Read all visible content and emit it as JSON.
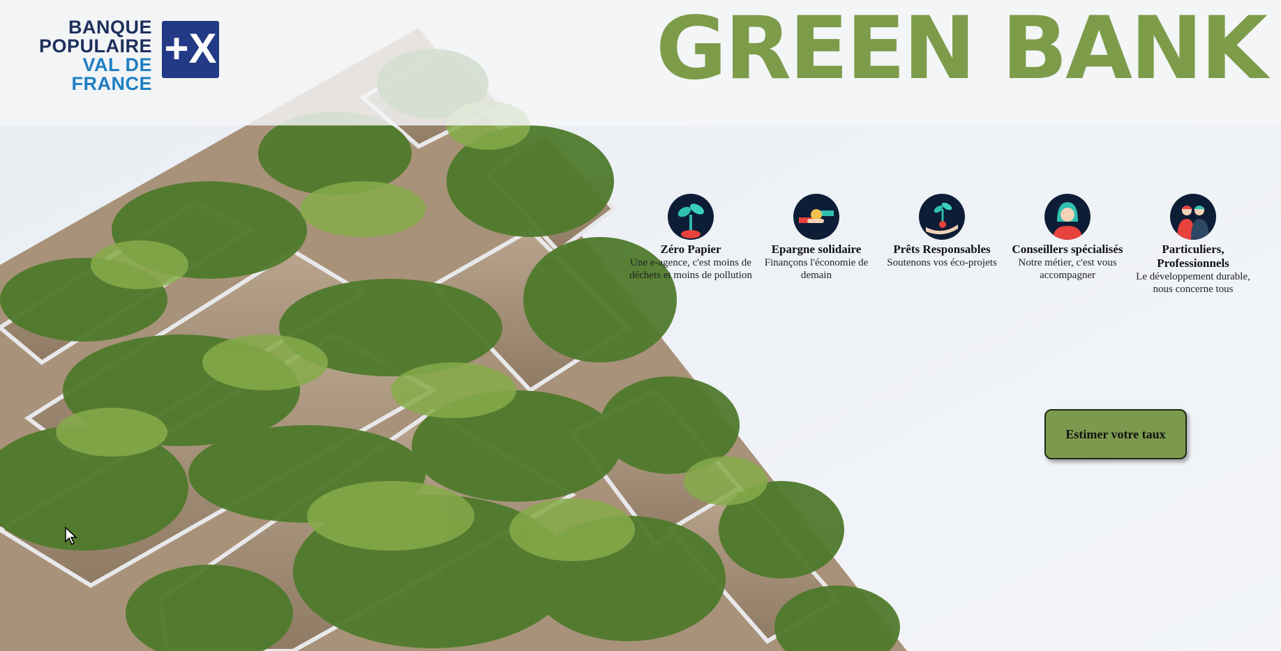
{
  "header": {
    "logo": {
      "line1": "BANQUE",
      "line2": "POPULAIRE",
      "line3": "VAL DE FRANCE",
      "mark": "+X"
    },
    "title": "GREEN BANK"
  },
  "features": [
    {
      "icon": "seedling-icon",
      "title": "Zéro Papier",
      "description": "Une e-agence, c'est moins de déchets et moins de pollution"
    },
    {
      "icon": "handshake-icon",
      "title": "Epargne solidaire",
      "description": "Finançons l'économie de demain"
    },
    {
      "icon": "plant-in-hand-icon",
      "title": "Prêts Responsables",
      "description": "Soutenons vos éco-projets"
    },
    {
      "icon": "advisor-avatar-icon",
      "title": "Conseillers spécialisés",
      "description": "Notre métier, c'est vous accompagner"
    },
    {
      "icon": "people-icon",
      "title": "Particuliers, Professionnels",
      "description": "Le développement durable, nous concerne tous"
    }
  ],
  "cta": {
    "label": "Estimer votre taux"
  },
  "colors": {
    "brand_green": "#7c9c4a",
    "logo_navy": "#1e2f5c",
    "logo_blue": "#1e7fc2",
    "icon_bg": "#0e1d36"
  }
}
